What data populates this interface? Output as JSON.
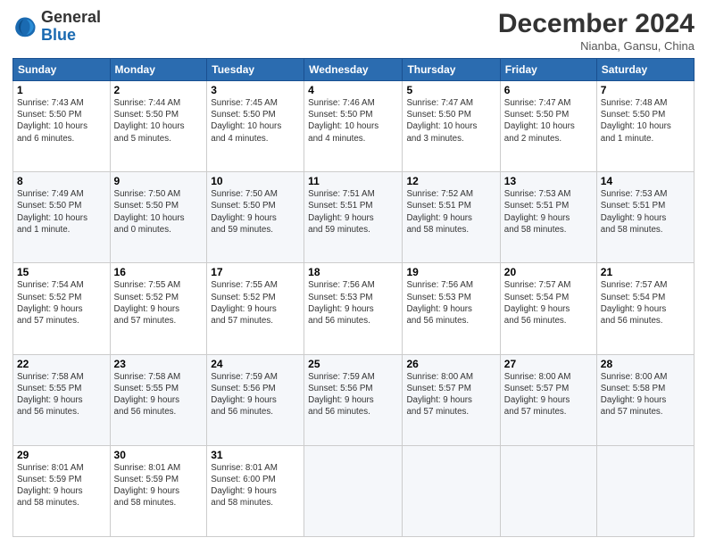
{
  "header": {
    "logo_general": "General",
    "logo_blue": "Blue",
    "title": "December 2024",
    "location": "Nianba, Gansu, China"
  },
  "calendar": {
    "days_of_week": [
      "Sunday",
      "Monday",
      "Tuesday",
      "Wednesday",
      "Thursday",
      "Friday",
      "Saturday"
    ],
    "weeks": [
      [
        {
          "day": "1",
          "info": "Sunrise: 7:43 AM\nSunset: 5:50 PM\nDaylight: 10 hours\nand 6 minutes."
        },
        {
          "day": "2",
          "info": "Sunrise: 7:44 AM\nSunset: 5:50 PM\nDaylight: 10 hours\nand 5 minutes."
        },
        {
          "day": "3",
          "info": "Sunrise: 7:45 AM\nSunset: 5:50 PM\nDaylight: 10 hours\nand 4 minutes."
        },
        {
          "day": "4",
          "info": "Sunrise: 7:46 AM\nSunset: 5:50 PM\nDaylight: 10 hours\nand 4 minutes."
        },
        {
          "day": "5",
          "info": "Sunrise: 7:47 AM\nSunset: 5:50 PM\nDaylight: 10 hours\nand 3 minutes."
        },
        {
          "day": "6",
          "info": "Sunrise: 7:47 AM\nSunset: 5:50 PM\nDaylight: 10 hours\nand 2 minutes."
        },
        {
          "day": "7",
          "info": "Sunrise: 7:48 AM\nSunset: 5:50 PM\nDaylight: 10 hours\nand 1 minute."
        }
      ],
      [
        {
          "day": "8",
          "info": "Sunrise: 7:49 AM\nSunset: 5:50 PM\nDaylight: 10 hours\nand 1 minute."
        },
        {
          "day": "9",
          "info": "Sunrise: 7:50 AM\nSunset: 5:50 PM\nDaylight: 10 hours\nand 0 minutes."
        },
        {
          "day": "10",
          "info": "Sunrise: 7:50 AM\nSunset: 5:50 PM\nDaylight: 9 hours\nand 59 minutes."
        },
        {
          "day": "11",
          "info": "Sunrise: 7:51 AM\nSunset: 5:51 PM\nDaylight: 9 hours\nand 59 minutes."
        },
        {
          "day": "12",
          "info": "Sunrise: 7:52 AM\nSunset: 5:51 PM\nDaylight: 9 hours\nand 58 minutes."
        },
        {
          "day": "13",
          "info": "Sunrise: 7:53 AM\nSunset: 5:51 PM\nDaylight: 9 hours\nand 58 minutes."
        },
        {
          "day": "14",
          "info": "Sunrise: 7:53 AM\nSunset: 5:51 PM\nDaylight: 9 hours\nand 58 minutes."
        }
      ],
      [
        {
          "day": "15",
          "info": "Sunrise: 7:54 AM\nSunset: 5:52 PM\nDaylight: 9 hours\nand 57 minutes."
        },
        {
          "day": "16",
          "info": "Sunrise: 7:55 AM\nSunset: 5:52 PM\nDaylight: 9 hours\nand 57 minutes."
        },
        {
          "day": "17",
          "info": "Sunrise: 7:55 AM\nSunset: 5:52 PM\nDaylight: 9 hours\nand 57 minutes."
        },
        {
          "day": "18",
          "info": "Sunrise: 7:56 AM\nSunset: 5:53 PM\nDaylight: 9 hours\nand 56 minutes."
        },
        {
          "day": "19",
          "info": "Sunrise: 7:56 AM\nSunset: 5:53 PM\nDaylight: 9 hours\nand 56 minutes."
        },
        {
          "day": "20",
          "info": "Sunrise: 7:57 AM\nSunset: 5:54 PM\nDaylight: 9 hours\nand 56 minutes."
        },
        {
          "day": "21",
          "info": "Sunrise: 7:57 AM\nSunset: 5:54 PM\nDaylight: 9 hours\nand 56 minutes."
        }
      ],
      [
        {
          "day": "22",
          "info": "Sunrise: 7:58 AM\nSunset: 5:55 PM\nDaylight: 9 hours\nand 56 minutes."
        },
        {
          "day": "23",
          "info": "Sunrise: 7:58 AM\nSunset: 5:55 PM\nDaylight: 9 hours\nand 56 minutes."
        },
        {
          "day": "24",
          "info": "Sunrise: 7:59 AM\nSunset: 5:56 PM\nDaylight: 9 hours\nand 56 minutes."
        },
        {
          "day": "25",
          "info": "Sunrise: 7:59 AM\nSunset: 5:56 PM\nDaylight: 9 hours\nand 56 minutes."
        },
        {
          "day": "26",
          "info": "Sunrise: 8:00 AM\nSunset: 5:57 PM\nDaylight: 9 hours\nand 57 minutes."
        },
        {
          "day": "27",
          "info": "Sunrise: 8:00 AM\nSunset: 5:57 PM\nDaylight: 9 hours\nand 57 minutes."
        },
        {
          "day": "28",
          "info": "Sunrise: 8:00 AM\nSunset: 5:58 PM\nDaylight: 9 hours\nand 57 minutes."
        }
      ],
      [
        {
          "day": "29",
          "info": "Sunrise: 8:01 AM\nSunset: 5:59 PM\nDaylight: 9 hours\nand 58 minutes."
        },
        {
          "day": "30",
          "info": "Sunrise: 8:01 AM\nSunset: 5:59 PM\nDaylight: 9 hours\nand 58 minutes."
        },
        {
          "day": "31",
          "info": "Sunrise: 8:01 AM\nSunset: 6:00 PM\nDaylight: 9 hours\nand 58 minutes."
        },
        {
          "day": "",
          "info": ""
        },
        {
          "day": "",
          "info": ""
        },
        {
          "day": "",
          "info": ""
        },
        {
          "day": "",
          "info": ""
        }
      ]
    ]
  }
}
